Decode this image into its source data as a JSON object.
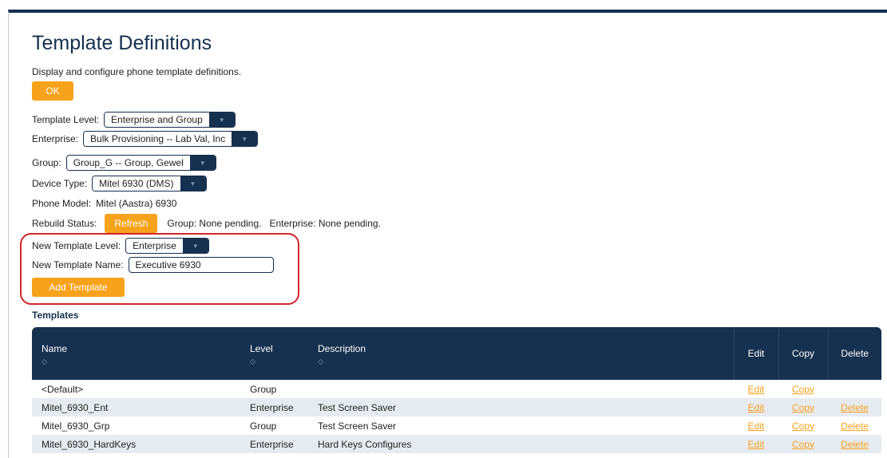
{
  "page": {
    "title": "Template Definitions",
    "subtitle": "Display and configure phone template definitions.",
    "ok_label": "OK"
  },
  "fields": {
    "template_level": {
      "label": "Template Level:",
      "value": "Enterprise and Group"
    },
    "enterprise": {
      "label": "Enterprise:",
      "value": "Bulk Provisioning -- Lab Val, Inc"
    },
    "group": {
      "label": "Group:",
      "value": "Group_G -- Group, Gewel"
    },
    "device_type": {
      "label": "Device Type:",
      "value": "Mitel 6930 (DMS)"
    },
    "phone_model": {
      "label": "Phone Model:",
      "value": "Mitel (Aastra) 6930"
    },
    "rebuild_status": {
      "label": "Rebuild Status:",
      "refresh_label": "Refresh",
      "status_text": "Group: None pending.   Enterprise: None pending."
    },
    "new_template_level": {
      "label": "New Template Level:",
      "value": "Enterprise"
    },
    "new_template_name": {
      "label": "New Template Name:",
      "value": "Executive 6930"
    },
    "add_template_label": "Add Template"
  },
  "templates": {
    "heading": "Templates",
    "columns": {
      "name": "Name",
      "level": "Level",
      "description": "Description",
      "edit": "Edit",
      "copy": "Copy",
      "delete": "Delete"
    },
    "rows": [
      {
        "name": "<Default>",
        "level": "Group",
        "description": "",
        "edit": "Edit",
        "copy": "Copy",
        "delete": ""
      },
      {
        "name": "Mitel_6930_Ent",
        "level": "Enterprise",
        "description": "Test Screen Saver",
        "edit": "Edit",
        "copy": "Copy",
        "delete": "Delete"
      },
      {
        "name": "Mitel_6930_Grp",
        "level": "Group",
        "description": "Test Screen Saver",
        "edit": "Edit",
        "copy": "Copy",
        "delete": "Delete"
      },
      {
        "name": "Mitel_6930_HardKeys",
        "level": "Enterprise",
        "description": "Hard Keys Configures",
        "edit": "Edit",
        "copy": "Copy",
        "delete": "Delete"
      }
    ]
  },
  "colors": {
    "navy": "#16304f",
    "accent_orange": "#f7a21b",
    "highlight_red": "#d1252c"
  }
}
